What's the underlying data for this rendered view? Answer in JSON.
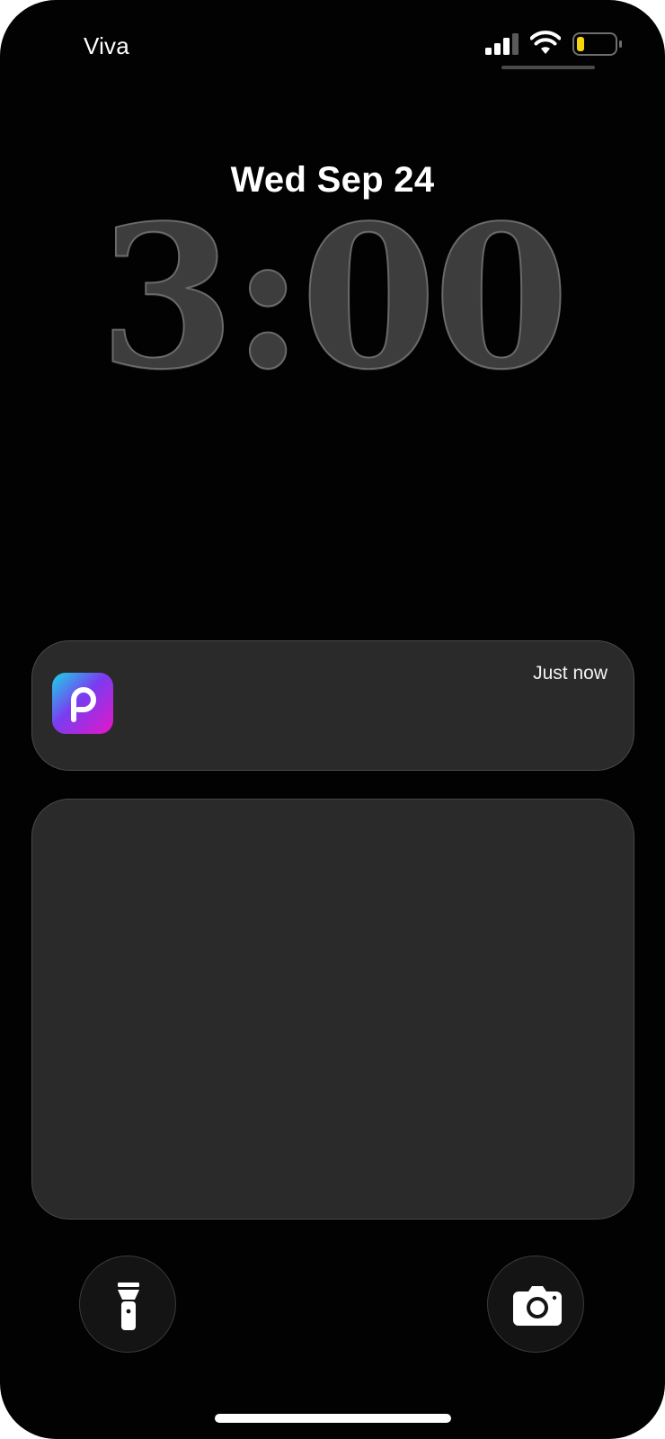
{
  "status_bar": {
    "carrier": "Viva",
    "signal_icon": "cellular-signal-icon",
    "wifi_icon": "wifi-icon",
    "battery_icon": "battery-icon",
    "battery_level": 0.15,
    "battery_color": "#f5d60a"
  },
  "lock_screen": {
    "date": "Wed Sep 24",
    "time": "3:00"
  },
  "notification": {
    "app_icon": "picsart-app-icon",
    "time": "Just now",
    "icon_gradient": [
      "#1ad6e8",
      "#7a3cf0",
      "#e516c8"
    ]
  },
  "controls": {
    "flashlight_icon": "flashlight-icon",
    "camera_icon": "camera-icon"
  }
}
